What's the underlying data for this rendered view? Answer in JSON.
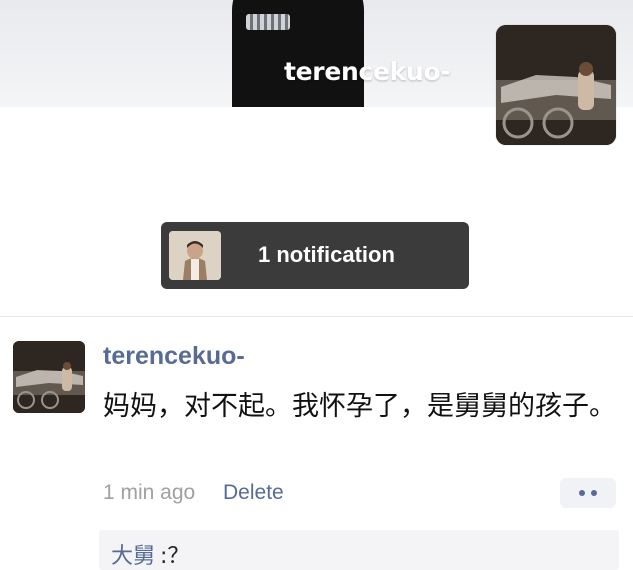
{
  "cover": {
    "username": "terencekuo-"
  },
  "notification": {
    "text": "1 notification"
  },
  "post": {
    "username": "terencekuo-",
    "text": "妈妈，对不起。我怀孕了，是舅舅的孩子。",
    "time": "1 min ago",
    "delete_label": "Delete"
  },
  "comments": [
    {
      "author": "大舅",
      "text": ":？"
    }
  ],
  "colors": {
    "link": "#576b95",
    "notification_bg": "#3b3b3b",
    "comment_bg": "#f4f4f6"
  }
}
